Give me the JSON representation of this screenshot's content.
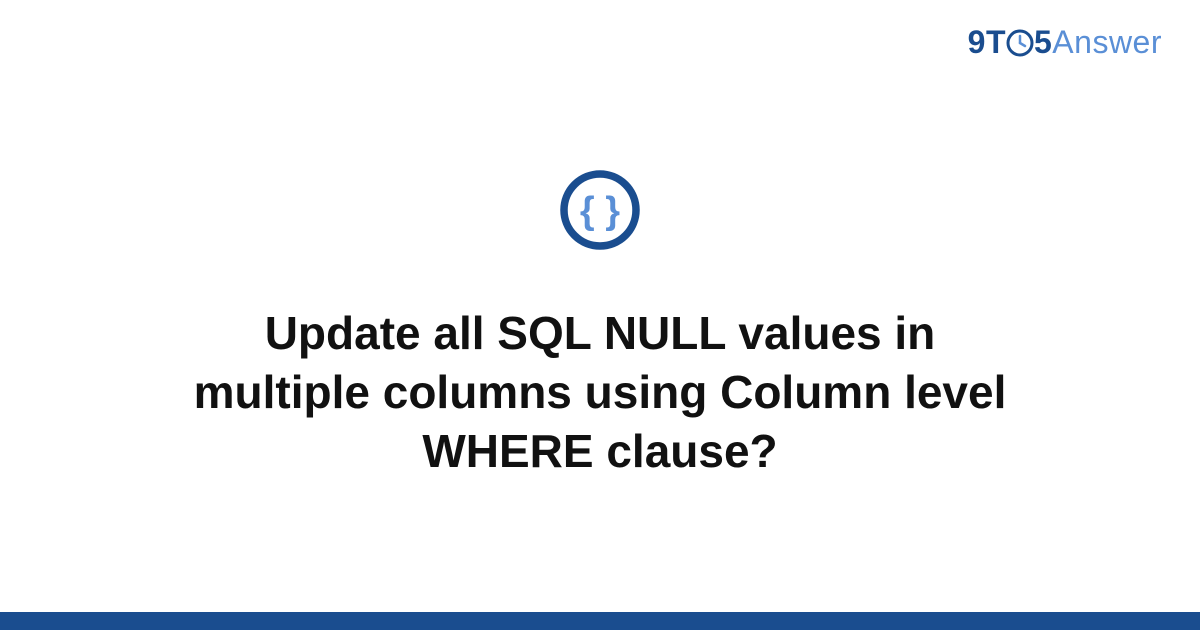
{
  "brand": {
    "prefix": "9T",
    "clock_icon": "clock-icon",
    "suffix": "5",
    "word": "Answer"
  },
  "main": {
    "icon": "code-braces-icon",
    "title": "Update all SQL NULL values in multiple columns using Column level WHERE clause?"
  },
  "colors": {
    "primary_dark": "#1a4d8f",
    "primary_light": "#5a8fd6",
    "text": "#111111"
  }
}
